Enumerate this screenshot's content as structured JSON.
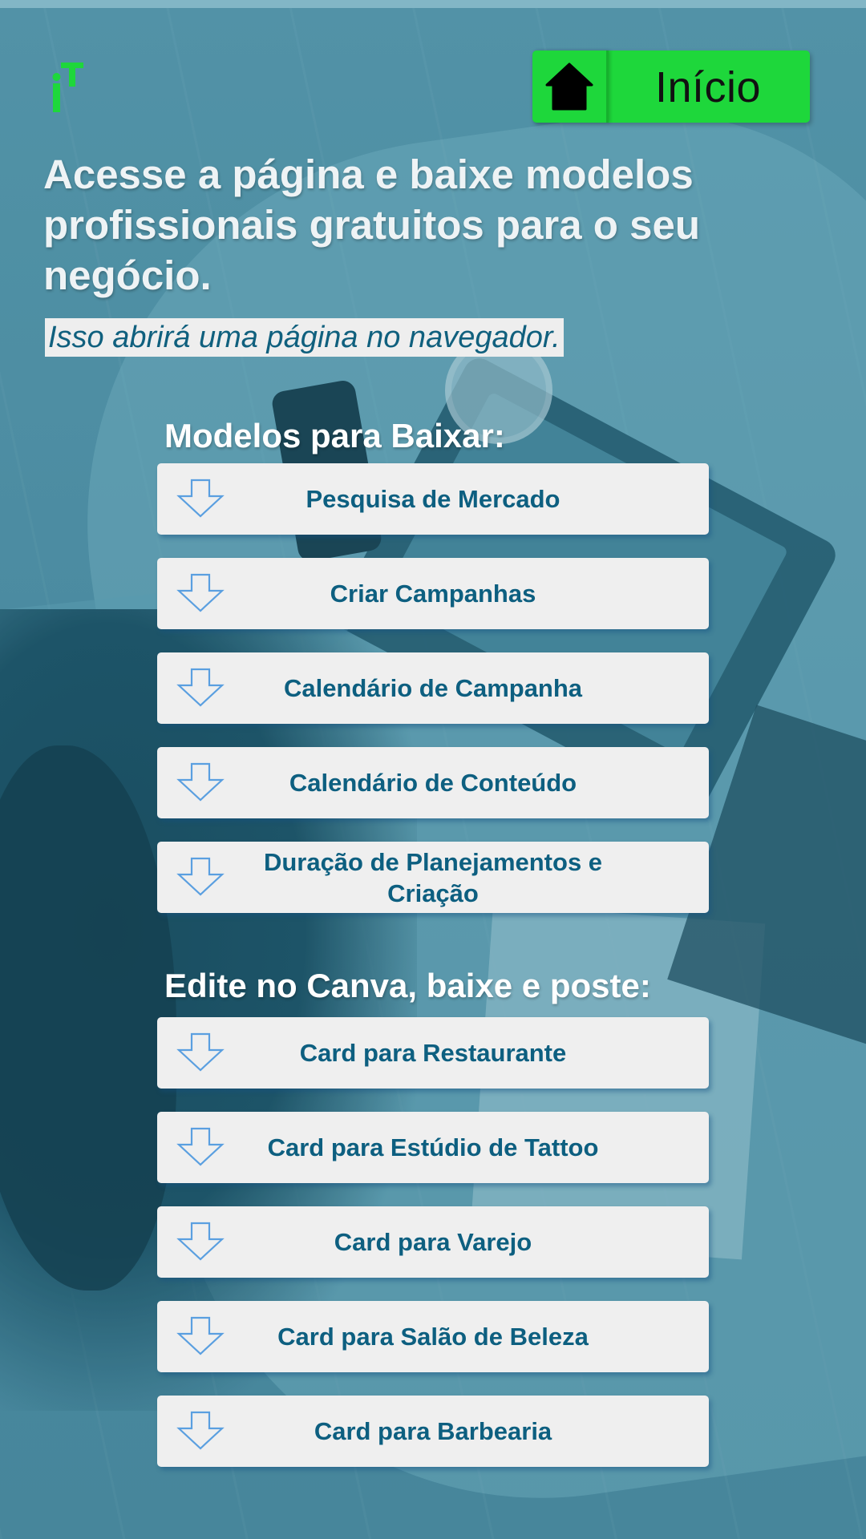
{
  "logo": {
    "text": "iT",
    "color": "#1ed73b"
  },
  "header": {
    "home_button": {
      "label": "Início",
      "icon": "home-icon",
      "background": "#1ed73b"
    }
  },
  "headline": "Acesse a página e baixe modelos profissionais gratuitos para o seu negócio.",
  "notice": "Isso abrirá uma página no navegador.",
  "sections": [
    {
      "title": "Modelos para Baixar:",
      "items": [
        {
          "label": "Pesquisa de Mercado",
          "icon": "download-arrow-icon"
        },
        {
          "label": "Criar Campanhas",
          "icon": "download-arrow-icon"
        },
        {
          "label": "Calendário de Campanha",
          "icon": "download-arrow-icon"
        },
        {
          "label": "Calendário de Conteúdo",
          "icon": "download-arrow-icon"
        },
        {
          "label": "Duração de Planejamentos e Criação",
          "icon": "download-arrow-icon"
        }
      ]
    },
    {
      "title": "Edite no Canva, baixe e poste:",
      "items": [
        {
          "label": "Card para Restaurante",
          "icon": "download-arrow-icon"
        },
        {
          "label": "Card para Estúdio de Tattoo",
          "icon": "download-arrow-icon"
        },
        {
          "label": "Card para Varejo",
          "icon": "download-arrow-icon"
        },
        {
          "label": "Card para Salão de Beleza",
          "icon": "download-arrow-icon"
        },
        {
          "label": "Card para Barbearia",
          "icon": "download-arrow-icon"
        }
      ]
    }
  ],
  "colors": {
    "accent_green": "#1ed73b",
    "button_text": "#0d5f80",
    "button_bg": "#efefef",
    "arrow_stroke": "#5a9fe0"
  }
}
